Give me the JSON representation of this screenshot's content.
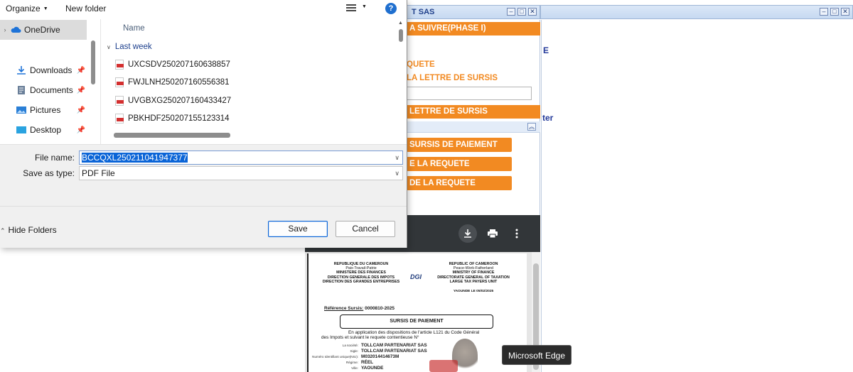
{
  "background_app": {
    "left_title": "T SAS",
    "orange_bar_1": "A SUIVRE(PHASE I)",
    "orange_text_1": "QUETE",
    "orange_text_2": "LA LETTRE DE SURSIS",
    "orange_bar_2": "LETTRE DE SURSIS",
    "buttons": [
      "SURSIS DE PAIEMENT",
      "E LA REQUETE",
      "DE LA REQUETE"
    ],
    "blue_frag_1": "E",
    "blue_frag_2": "ter",
    "colors": {
      "accent": "#f28a22",
      "titlebar": "#c6d9f1"
    }
  },
  "pdf_viewer": {
    "toolbar_icons": [
      "download-icon",
      "print-icon",
      "more-vert-icon"
    ],
    "page": {
      "left_header": [
        "REPUBLIQUE DU CAMEROUN",
        "Paix-Travail-Patrie",
        "MINISTERE DES FINANCES",
        "DIRECTION GENERALE DES IMPOTS",
        "DIRECTION DES GRANDES ENTREPRISES"
      ],
      "right_header": [
        "REPUBLIC OF CAMEROON",
        "Peace-Work-Fatherland",
        "MINISTRY OF FINANCE",
        "DIRECTORATE GENERAL OF TAXATION",
        "LARGE TAX PAYERS UNIT"
      ],
      "logo_text": "DGI",
      "date_line": "YAOUNDE LE 05/02/2025",
      "ref_label": "Référence Sursis:",
      "ref_value": "0000810-2025",
      "box_title": "SURSIS DE PAIEMENT",
      "body_line_1": "En application des dispositions de l'article L121 du Code Général",
      "body_line_2": "des Impots et suivant le requete contentieuse N°",
      "fields": [
        {
          "k": "La société:",
          "v": "TOLLCAM PARTENARIAT SAS"
        },
        {
          "k": "Sigle:",
          "v": "TOLLCAM PARTENARIAT SAS"
        },
        {
          "k": "Numéro Identifiant unique(NIU):",
          "v": "M032014414673M"
        },
        {
          "k": "Régime:",
          "v": "RÉEL"
        },
        {
          "k": "Ville:",
          "v": "YAOUNDE"
        }
      ]
    }
  },
  "tooltip": "Microsoft Edge",
  "dialog": {
    "command_bar": {
      "organize": "Organize",
      "new_folder": "New folder",
      "help": "?"
    },
    "nav": [
      {
        "label": "OneDrive",
        "icon": "cloud-icon",
        "selected": true,
        "pinned": false
      },
      {
        "label": "Downloads",
        "icon": "download-folder-icon",
        "selected": false,
        "pinned": true
      },
      {
        "label": "Documents",
        "icon": "documents-icon",
        "selected": false,
        "pinned": true
      },
      {
        "label": "Pictures",
        "icon": "pictures-icon",
        "selected": false,
        "pinned": true
      },
      {
        "label": "Desktop",
        "icon": "desktop-icon",
        "selected": false,
        "pinned": true
      }
    ],
    "file_list": {
      "column_name": "Name",
      "group": "Last week",
      "files": [
        "UXCSDV250207160638857",
        "FWJLNH250207160556381",
        "UVGBXG250207160433427",
        "PBKHDF250207155123314"
      ]
    },
    "file_name_label": "File name:",
    "file_name_value": "BCCQXL250211041947377",
    "save_as_type_label": "Save as type:",
    "save_as_type_value": "PDF File",
    "hide_folders": "Hide Folders",
    "save_button": "Save",
    "cancel_button": "Cancel"
  }
}
